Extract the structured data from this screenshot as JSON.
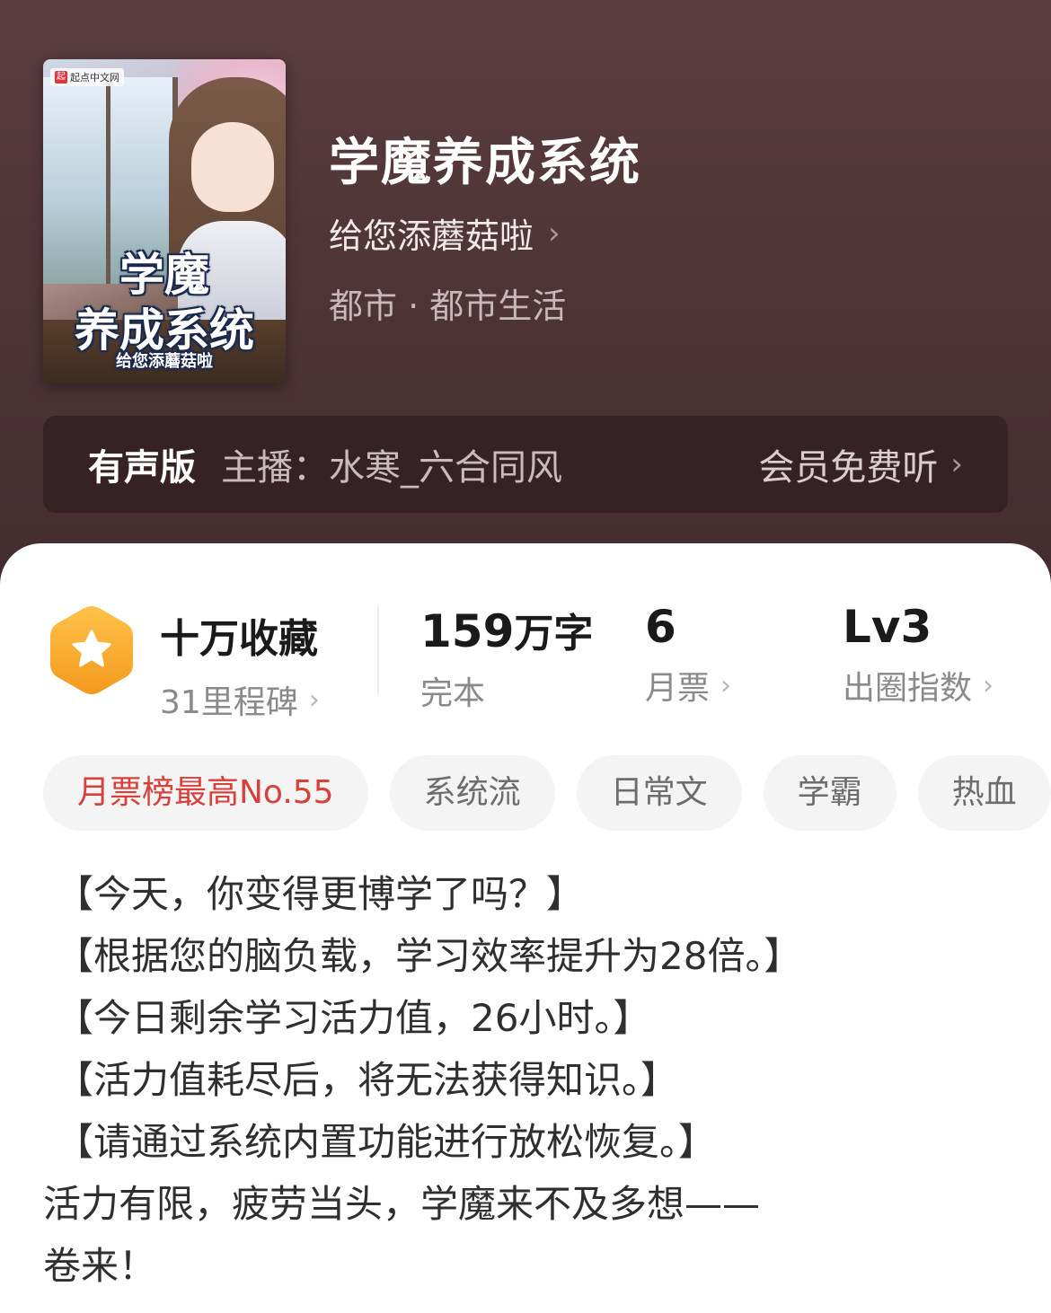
{
  "cover": {
    "brand": "起点中文网",
    "brand_mark": "起",
    "title_line1": "学魔",
    "title_line2": "养成系统",
    "author": "给您添蘑菇啦"
  },
  "book": {
    "title": "学魔养成系统",
    "author": "给您添蘑菇啦",
    "category": "都市 · 都市生活"
  },
  "audio": {
    "label": "有声版",
    "host": "主播：水寒_六合同风",
    "vip_label": "会员免费听"
  },
  "stats": {
    "collect_main": "十万收藏",
    "collect_sub": "31里程碑",
    "words_num": "159",
    "words_unit": "万字",
    "words_sub": "完本",
    "votes_main": "6",
    "votes_sub": "月票",
    "level_main": "Lv3",
    "level_sub": "出圈指数"
  },
  "tags": [
    {
      "label": "月票榜最高No.55"
    },
    {
      "label": "系统流"
    },
    {
      "label": "日常文"
    },
    {
      "label": "学霸"
    },
    {
      "label": "热血"
    }
  ],
  "description": [
    "【今天，你变得更博学了吗？】",
    "【根据您的脑负载，学习效率提升为28倍。】",
    "【今日剩余学习活力值，26小时。】",
    "【活力值耗尽后，将无法获得知识。】",
    "【请通过系统内置功能进行放松恢复。】",
    "活力有限，疲劳当头，学魔来不及多想——",
    "卷来！"
  ],
  "icons": {
    "chevron": "chevron-right-icon",
    "collect": "star-hexagon-icon"
  },
  "colors": {
    "header_bg": "#4e3436",
    "accent_orange": "#f5a623",
    "rank_red": "#d9403b"
  }
}
